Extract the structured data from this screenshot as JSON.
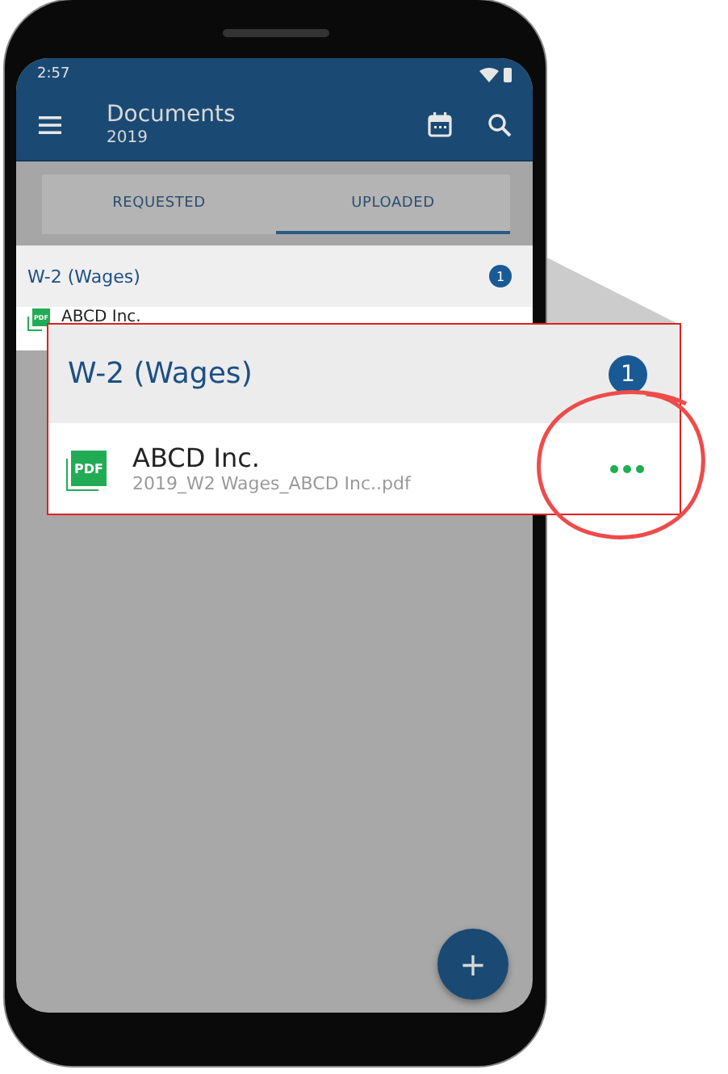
{
  "status_bar": {
    "time": "2:57"
  },
  "app_bar": {
    "title": "Documents",
    "subtitle": "2019"
  },
  "tabs": [
    {
      "label": "REQUESTED",
      "selected": false
    },
    {
      "label": "UPLOADED",
      "selected": true
    }
  ],
  "group": {
    "title": "W-2 (Wages)",
    "count": "1",
    "items": [
      {
        "name": "ABCD Inc.",
        "file_type": "PDF"
      }
    ]
  },
  "callout": {
    "group_title": "W-2 (Wages)",
    "count": "1",
    "item": {
      "name": "ABCD Inc.",
      "file": "2019_W2 Wages_ABCD Inc..pdf",
      "file_type": "PDF"
    }
  },
  "fab": {
    "label": "+"
  }
}
